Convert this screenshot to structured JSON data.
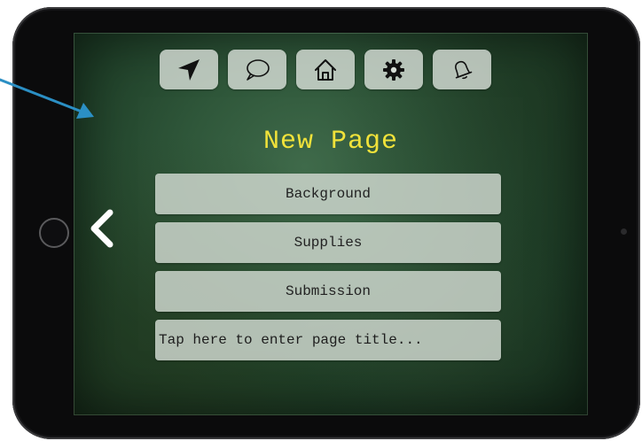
{
  "page": {
    "title": "New Page"
  },
  "toolbar": {
    "buttons": [
      {
        "icon": "navigation-arrow-icon"
      },
      {
        "icon": "chat-bubble-icon"
      },
      {
        "icon": "home-icon"
      },
      {
        "icon": "gear-icon"
      },
      {
        "icon": "bell-icon"
      }
    ]
  },
  "menu": {
    "items": [
      {
        "label": "Background"
      },
      {
        "label": "Supplies"
      },
      {
        "label": "Submission"
      }
    ],
    "title_input": {
      "placeholder": "Tap here to enter page title..."
    }
  },
  "colors": {
    "title": "#f0e23a",
    "annotation_arrow": "#2b8fc4",
    "button_fill": "#d7ded7"
  },
  "icons": {
    "back": "chevron-left-icon"
  }
}
